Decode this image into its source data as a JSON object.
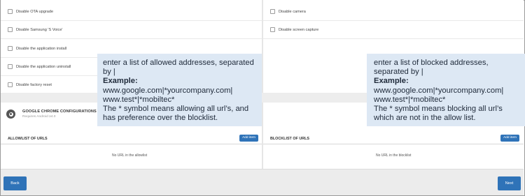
{
  "left_options": [
    {
      "label": "Disable OTA upgrade"
    },
    {
      "label": "Disable Samsung 'S Voice'"
    },
    {
      "label": "Disable the application install"
    },
    {
      "label": "Disable the application uninstall"
    },
    {
      "label": "Disable factory reset"
    }
  ],
  "right_options": [
    {
      "label": "Disable camera"
    },
    {
      "label": "Disable screen capture"
    }
  ],
  "chrome": {
    "title": "GOOGLE CHROME CONFIGURATIONS",
    "subtitle": "Requires Android ≥4.0"
  },
  "allowlist": {
    "title": "ALLOWLIST OF URLS",
    "add_label": "Add item",
    "empty": "No URL in the allowlist"
  },
  "blocklist": {
    "title": "BLOCKLIST OF URLS",
    "add_label": "Add item",
    "empty": "No URL in the blocklist"
  },
  "footer": {
    "back": "Back",
    "next": "Next"
  },
  "callouts": {
    "left": {
      "intro": "enter a list of allowed addresses, separated by |",
      "example_label": "Example:",
      "example": "www.google.com|*yourcompany.com|\nwww.test*|*mobiltec*",
      "note": "The * symbol means allowing all url’s, and has preference over the blocklist."
    },
    "right": {
      "intro": "enter a list of blocked addresses, separated by |",
      "example_label": "Example:",
      "example": "www.google.com|*yourcompany.com|\nwww.test*|*mobiltec*",
      "note": "The * symbol means blocking all url’s which are not in the allow list."
    }
  },
  "colors": {
    "primary_button": "#2f73b8",
    "callout_bg": "#dde8f4"
  }
}
